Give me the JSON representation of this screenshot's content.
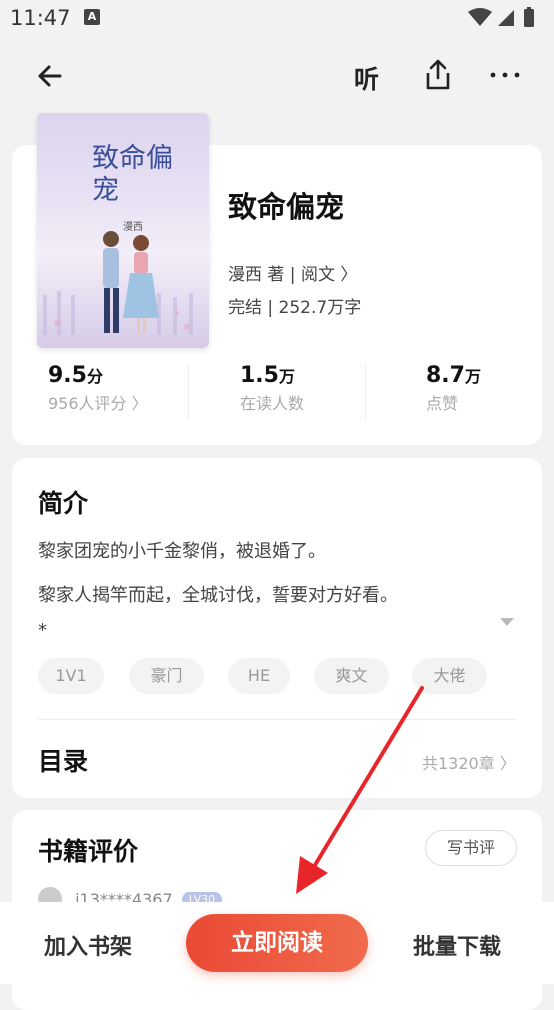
{
  "status_bar": {
    "time": "11:47",
    "notif_letter": "A"
  },
  "top_bar": {
    "listen_label": "听"
  },
  "book": {
    "title": "致命偏宠",
    "author_line": "漫西 著 | 阅文 〉",
    "status_line": "完结 | 252.7万字",
    "cover": {
      "title": "致命偏宠",
      "author": "漫西"
    }
  },
  "stats": [
    {
      "value": "9.5",
      "unit": "分",
      "label": "956人评分 〉"
    },
    {
      "value": "1.5",
      "unit": "万",
      "label": "在读人数"
    },
    {
      "value": "8.7",
      "unit": "万",
      "label": "点赞"
    }
  ],
  "intro": {
    "title": "简介",
    "lines": [
      "黎家团宠的小千金黎俏，被退婚了。",
      "黎家人揭竿而起，全城讨伐，誓要对方好看。",
      "*"
    ]
  },
  "tags": [
    "1V1",
    "豪门",
    "HE",
    "爽文",
    "大佬"
  ],
  "toc": {
    "title": "目录",
    "count": "共1320章 〉"
  },
  "reviews": {
    "title": "书籍评价",
    "write_label": "写书评",
    "first_user": "i13****4367",
    "first_level": "LV30"
  },
  "bottom_bar": {
    "add_shelf": "加入书架",
    "read_now": "立即阅读",
    "batch_download": "批量下载"
  },
  "colors": {
    "accent": "#ea4a35",
    "annotation_arrow": "#e8262a"
  }
}
